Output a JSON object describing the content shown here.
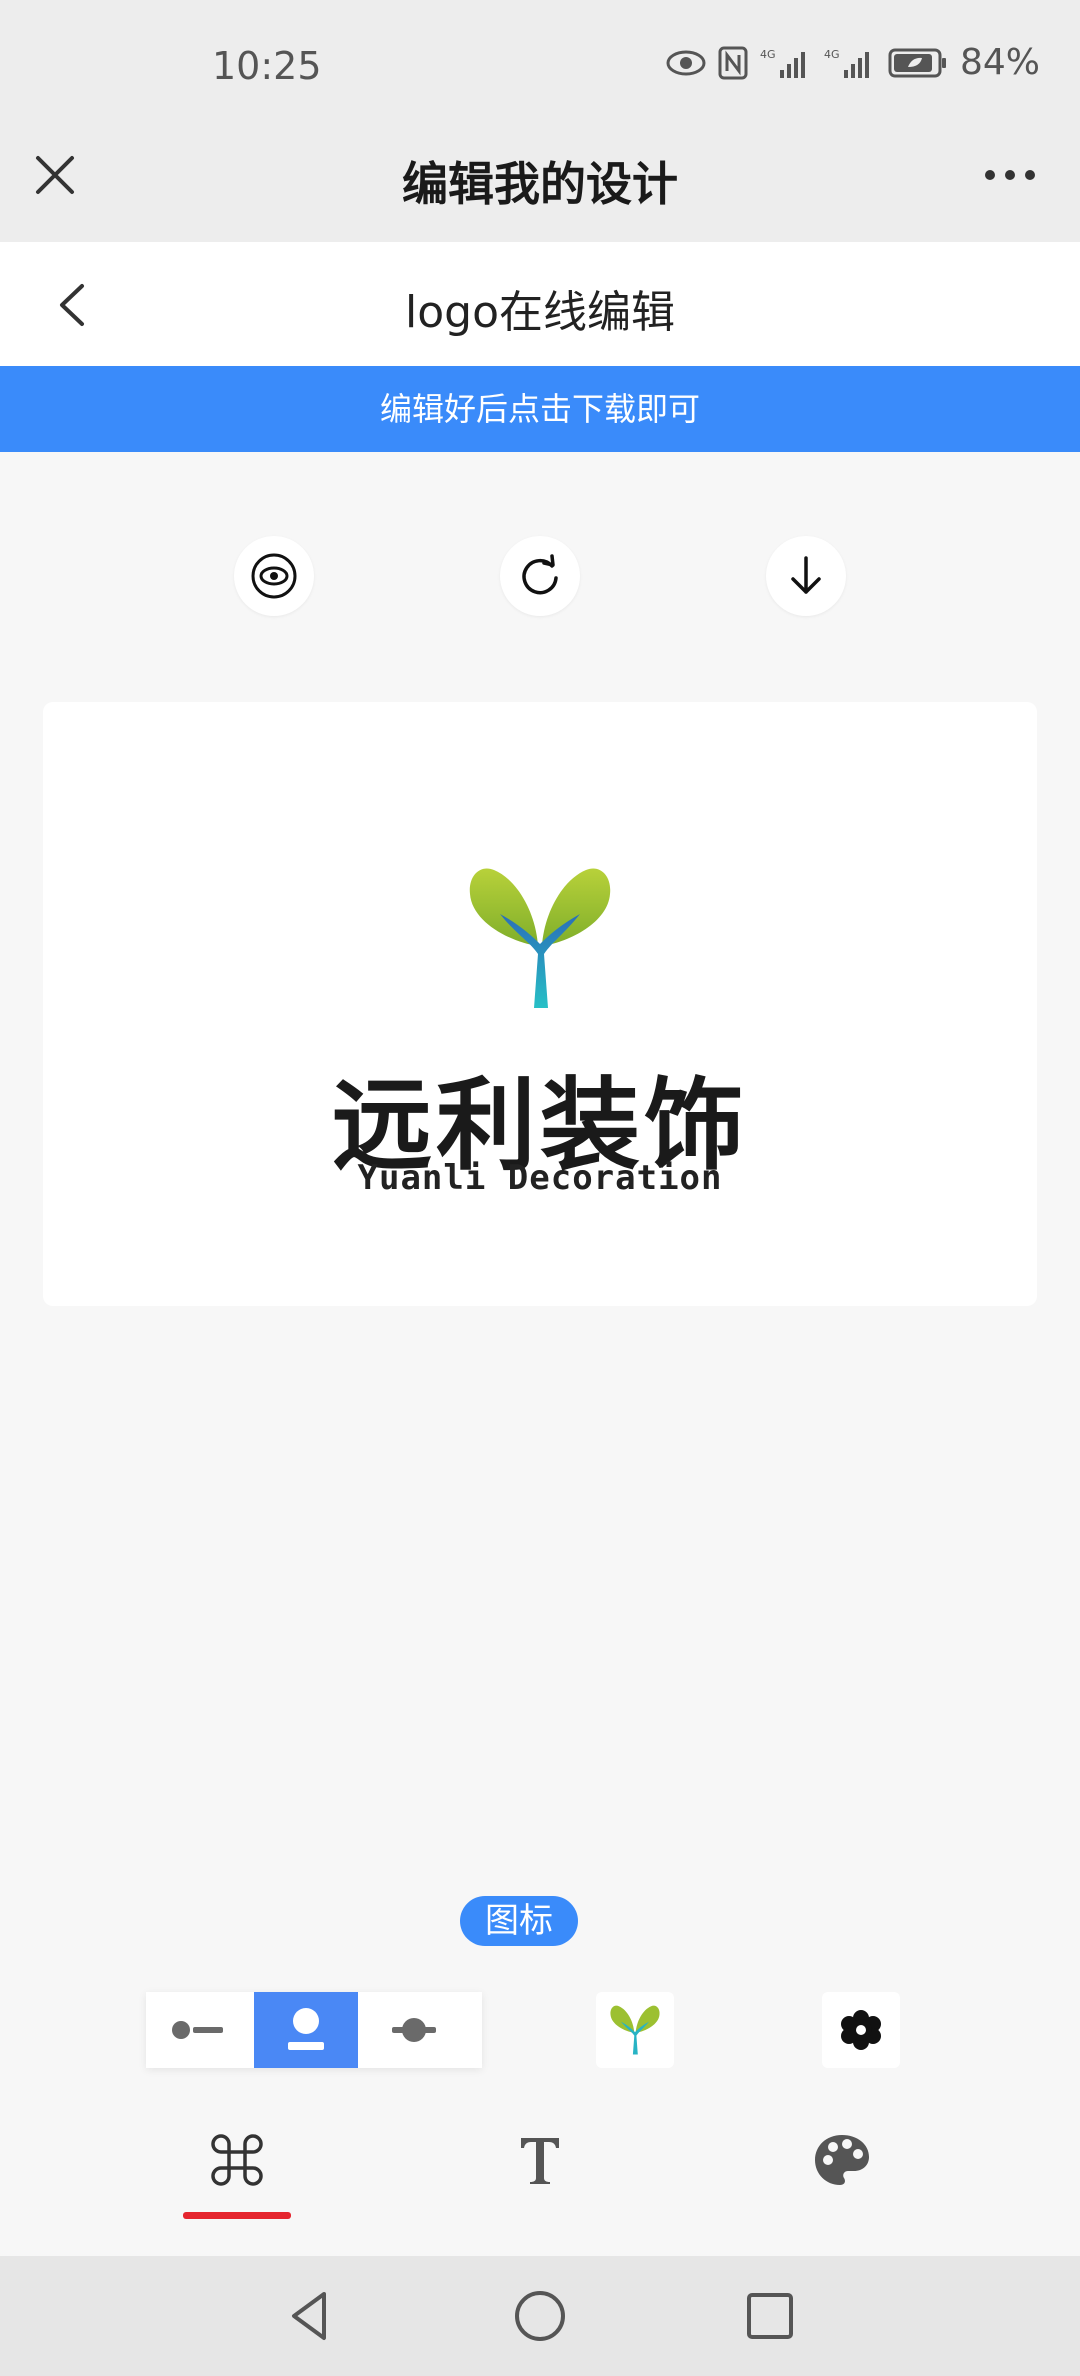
{
  "status_bar": {
    "time": "10:25",
    "battery": "84%",
    "network": "4G"
  },
  "header": {
    "title": "编辑我的设计"
  },
  "nav": {
    "title": "logo在线编辑"
  },
  "banner": {
    "text": "编辑好后点击下载即可"
  },
  "tools": [
    "preview",
    "reset",
    "download"
  ],
  "logo": {
    "name_cn": "远利装饰",
    "name_en": "Yuanli Decoration"
  },
  "layout_label": "图标",
  "layout_options": [
    "icon-left",
    "icon-top",
    "icon-center"
  ],
  "active_layout": "icon-top",
  "tabs": [
    "icon",
    "text",
    "color"
  ],
  "active_tab": "icon",
  "colors": {
    "accent": "#3a8bfa",
    "tab_indicator": "#e5252e",
    "leaf_green": "#9cc031",
    "stem_teal": "#27b3c4"
  }
}
